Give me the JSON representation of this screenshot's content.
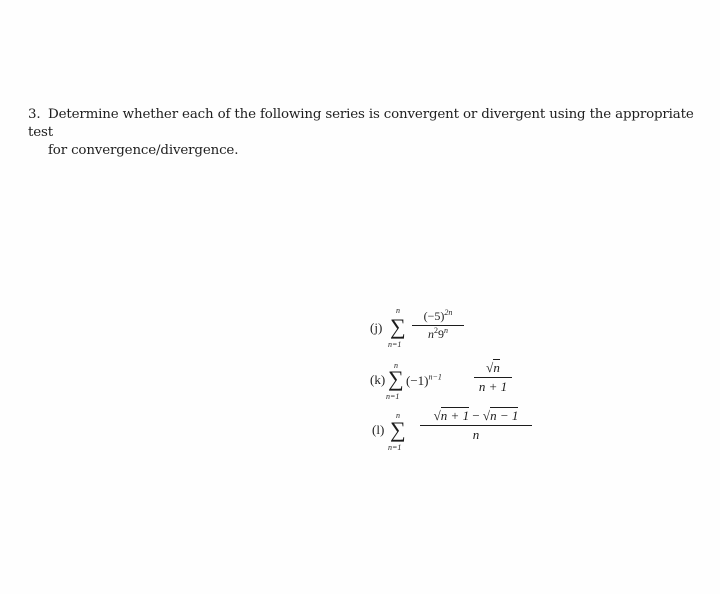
{
  "problem": {
    "number": "3.",
    "line1": "Determine whether each of the following series is convergent or divergent using the appropriate test",
    "line2": "for convergence/divergence."
  },
  "series": [
    {
      "label": "(j)",
      "sum_upper": "n",
      "sum_lower": "n=1",
      "numerator_base": "(−5)",
      "numerator_exp": "2n",
      "denominator_base1": "n",
      "denominator_exp1": "2",
      "denominator_base2": "9",
      "denominator_exp2": "n"
    },
    {
      "label": "(k)",
      "sum_upper": "n",
      "sum_lower": "n=1",
      "factor_base": "(−1)",
      "factor_exp": "n−1",
      "numerator_radicand": "n",
      "denominator": "n + 1"
    },
    {
      "label": "(l)",
      "sum_upper": "n",
      "sum_lower": "n=1",
      "numerator_radicand1": "n + 1",
      "numerator_minus": " − ",
      "numerator_radicand2": "n − 1",
      "denominator": "n"
    }
  ],
  "symbols": {
    "sigma": "∑",
    "sqrt": "√"
  }
}
